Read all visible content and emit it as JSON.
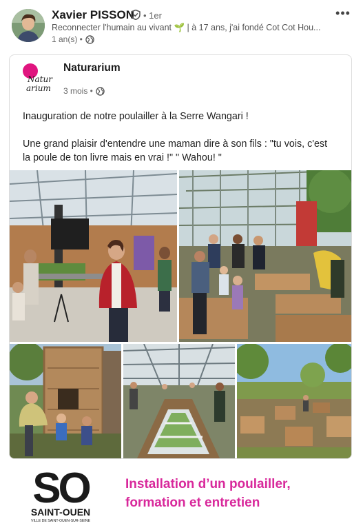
{
  "post": {
    "author_name": "Xavier PISSON",
    "degree": "• 1er",
    "headline": "Reconnecter l'humain au vivant 🌱 | à 17 ans, j'ai fondé Cot Cot Hou...",
    "time": "1 an(s) •",
    "more_label": "•••"
  },
  "shared": {
    "company_name": "Naturarium",
    "logo_text_line1": "Natur",
    "logo_text_line2": "arium",
    "time": "3 mois •",
    "paragraphs": [
      "Inauguration de notre poulailler à la Serre Wangari !",
      "Une grand plaisir d'entendre une maman dire à son fils : \"tu vois, c'est la poule de ton livre mais en vrai !\" \" Wahou! \""
    ]
  },
  "footer": {
    "logo_big": "SO",
    "logo_city": "SAINT-OUEN",
    "logo_small": "VILLE DE SAINT-OUEN-SUR-SEINE",
    "caption_line1": "Installation d’un poulailler,",
    "caption_line2": "formation et entretien"
  },
  "colors": {
    "accent_pink": "#d8289b",
    "logo_pink": "#e0157f"
  }
}
